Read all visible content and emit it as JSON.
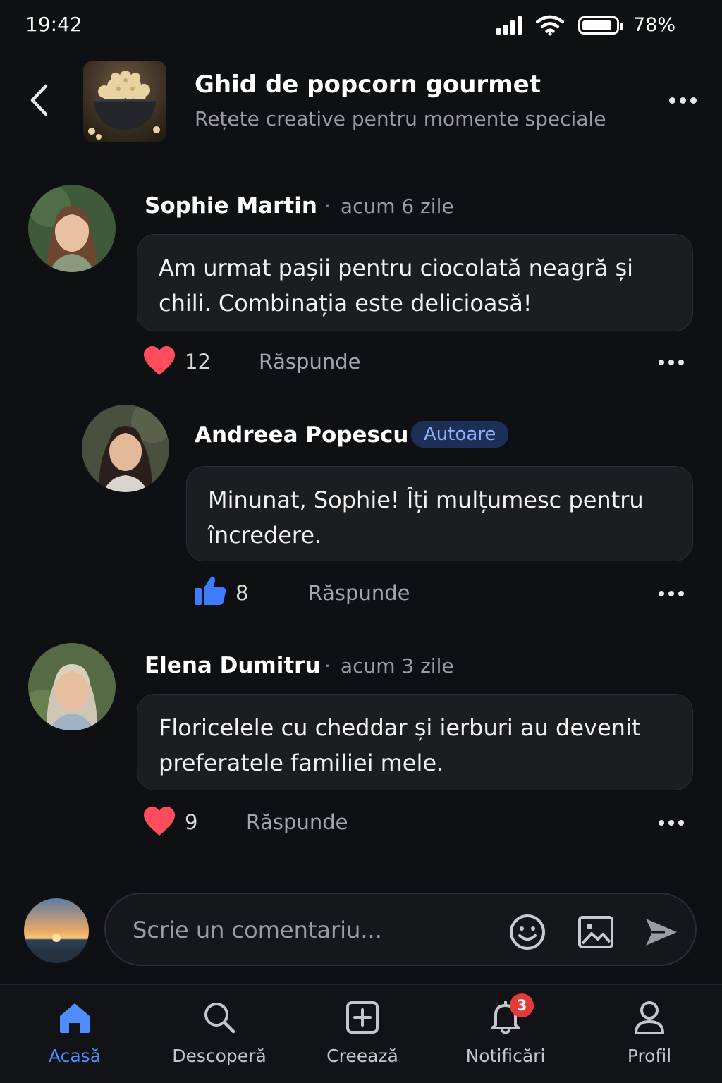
{
  "status_bar": {
    "time": "19:42",
    "battery_percent": "78%",
    "battery_level": 0.78,
    "icons": [
      "signal-icon",
      "wifi-icon",
      "battery-icon"
    ]
  },
  "header": {
    "back_icon": "chevron-left-icon",
    "thumbnail": "popcorn-bowl-image",
    "title": "Ghid de popcorn gourmet",
    "subtitle": "Rețete creative pentru momente speciale",
    "more_icon": "more-horizontal-icon"
  },
  "comments": [
    {
      "author": "Sophie Martin",
      "time": "acum 6 zile",
      "text": "Am urmat pașii pentru ciocolată neagră și chili. Combinația este delicioasă!",
      "reaction_icon": "heart-icon",
      "reaction_count": "12",
      "reply_label": "Răspunde"
    },
    {
      "author": "Andreea Popescu",
      "badge": "Autoare",
      "text": "Minunat, Sophie! Îți mulțumesc pentru încredere.",
      "reaction_icon": "thumbs-up-icon",
      "reaction_count": "8",
      "reply_label": "Răspunde"
    },
    {
      "author": "Elena Dumitru",
      "time": "acum 3 zile",
      "text": "Floricelele cu cheddar și ierburi au devenit preferatele familiei mele.",
      "reaction_icon": "heart-icon",
      "reaction_count": "9",
      "reply_label": "Răspunde"
    }
  ],
  "composer": {
    "placeholder": "Scrie un comentariu...",
    "icons": [
      "emoji-icon",
      "image-icon",
      "send-icon"
    ]
  },
  "bottom_nav": {
    "items": [
      {
        "label": "Acasă",
        "icon": "home-icon",
        "active": true
      },
      {
        "label": "Descoperă",
        "icon": "search-icon"
      },
      {
        "label": "Creează",
        "icon": "plus-square-icon"
      },
      {
        "label": "Notificări",
        "icon": "bell-icon",
        "badge": "3"
      },
      {
        "label": "Profil",
        "icon": "user-icon"
      }
    ]
  },
  "colors": {
    "background": "#0f1013",
    "bubble": "#1c1d21",
    "accent": "#4d8dff",
    "heart": "#ff4d5e",
    "badge_red": "#e53a3a"
  }
}
